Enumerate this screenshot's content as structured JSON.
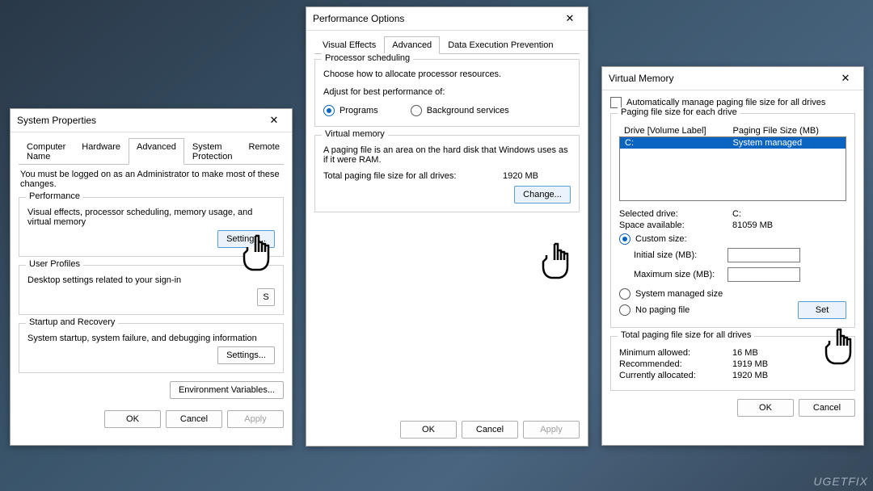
{
  "sysprops": {
    "title": "System Properties",
    "tabs": [
      "Computer Name",
      "Hardware",
      "Advanced",
      "System Protection",
      "Remote"
    ],
    "active_tab": 2,
    "notice": "You must be logged on as an Administrator to make most of these changes.",
    "performance": {
      "legend": "Performance",
      "desc": "Visual effects, processor scheduling, memory usage, and virtual memory",
      "settings_btn": "Settings..."
    },
    "userprofiles": {
      "legend": "User Profiles",
      "desc": "Desktop settings related to your sign-in",
      "settings_btn": "S"
    },
    "startup": {
      "legend": "Startup and Recovery",
      "desc": "System startup, system failure, and debugging information",
      "settings_btn": "Settings..."
    },
    "env_btn": "Environment Variables...",
    "ok": "OK",
    "cancel": "Cancel",
    "apply": "Apply"
  },
  "perfoptions": {
    "title": "Performance Options",
    "tabs": [
      "Visual Effects",
      "Advanced",
      "Data Execution Prevention"
    ],
    "active_tab": 1,
    "scheduling": {
      "legend": "Processor scheduling",
      "line1": "Choose how to allocate processor resources.",
      "line2": "Adjust for best performance of:",
      "opt_programs": "Programs",
      "opt_background": "Background services"
    },
    "vmem": {
      "legend": "Virtual memory",
      "line1": "A paging file is an area on the hard disk that Windows uses as if it were RAM.",
      "total_label": "Total paging file size for all drives:",
      "total_value": "1920 MB",
      "change_btn": "Change..."
    },
    "ok": "OK",
    "cancel": "Cancel",
    "apply": "Apply"
  },
  "vmem_dlg": {
    "title": "Virtual Memory",
    "auto_chk": "Automatically manage paging file size for all drives",
    "group_legend": "Paging file size for each drive",
    "col_drive": "Drive  [Volume Label]",
    "col_size": "Paging File Size (MB)",
    "row_drive": "C:",
    "row_value": "System managed",
    "selected_drive_label": "Selected drive:",
    "selected_drive_value": "C:",
    "space_label": "Space available:",
    "space_value": "81059 MB",
    "opt_custom": "Custom size:",
    "initial_label": "Initial size (MB):",
    "max_label": "Maximum size (MB):",
    "opt_sysmanaged": "System managed size",
    "opt_nopaging": "No paging file",
    "set_btn": "Set",
    "totals_legend": "Total paging file size for all drives",
    "min_label": "Minimum allowed:",
    "min_value": "16 MB",
    "rec_label": "Recommended:",
    "rec_value": "1919 MB",
    "cur_label": "Currently allocated:",
    "cur_value": "1920 MB",
    "ok": "OK",
    "cancel": "Cancel"
  },
  "watermark": "UGETFIX"
}
